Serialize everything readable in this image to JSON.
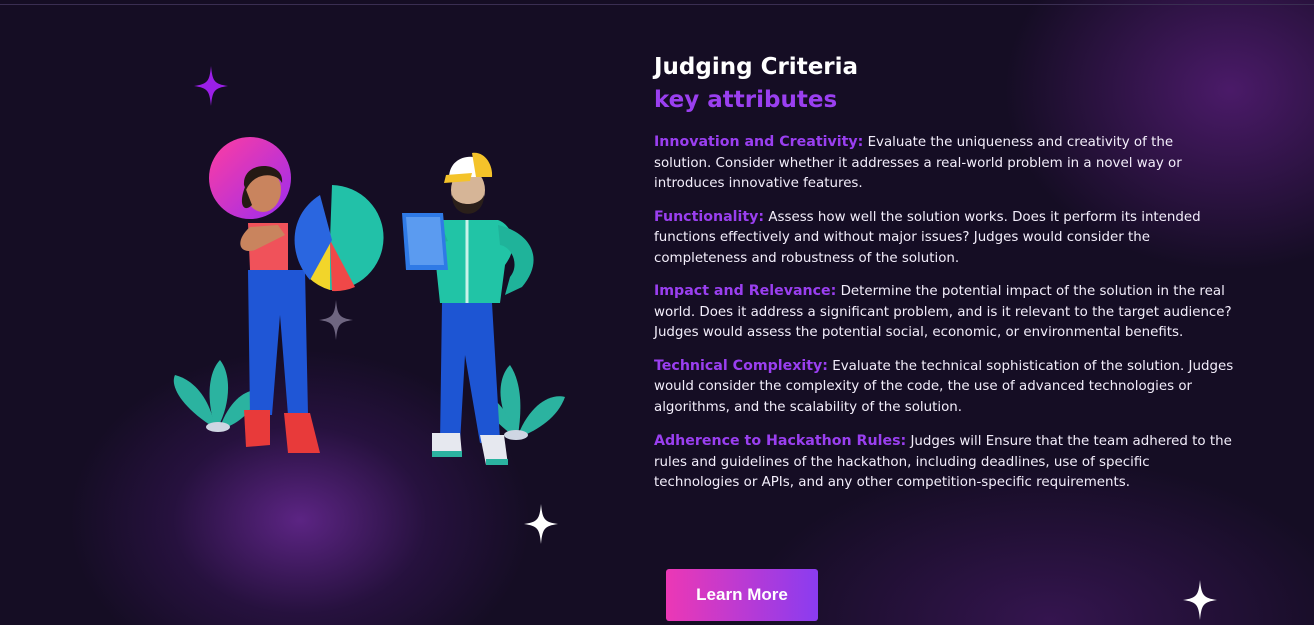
{
  "section": {
    "title": "Judging Criteria",
    "subtitle": "key attributes"
  },
  "criteria": [
    {
      "label": "Innovation and Creativity:",
      "text": " Evaluate the uniqueness and creativity of the solution. Consider whether it addresses a real-world problem in a novel way or introduces innovative features."
    },
    {
      "label": "Functionality:",
      "text": " Assess how well the solution works. Does it perform its intended functions effectively and without major issues? Judges would consider the completeness and robustness of the solution."
    },
    {
      "label": "Impact and Relevance:",
      "text": " Determine the potential impact of the solution in the real world. Does it address a significant problem, and is it relevant to the target audience? Judges would assess the potential social, economic, or environmental benefits."
    },
    {
      "label": "Technical Complexity:",
      "text": " Evaluate the technical sophistication of the solution. Judges would consider the complexity of the code, the use of advanced technologies or algorithms, and the scalability of the solution."
    },
    {
      "label": "Adherence to Hackathon Rules:",
      "text": " Judges will Ensure that the team adhered to the rules and guidelines of the hackathon, including deadlines, use of specific technologies or APIs, and any other competition-specific requirements."
    }
  ],
  "cta": {
    "label": "Learn More"
  },
  "colors": {
    "accent": "#9a3ff0",
    "background": "#150d24",
    "button_start": "#ec38b5",
    "button_end": "#8a3cf0"
  },
  "icons": {
    "sparkles": [
      "sparkle-purple-icon",
      "sparkle-gray-icon",
      "sparkle-white-icon",
      "sparkle-white-corner-icon"
    ],
    "illustration": "team-analytics-illustration"
  }
}
